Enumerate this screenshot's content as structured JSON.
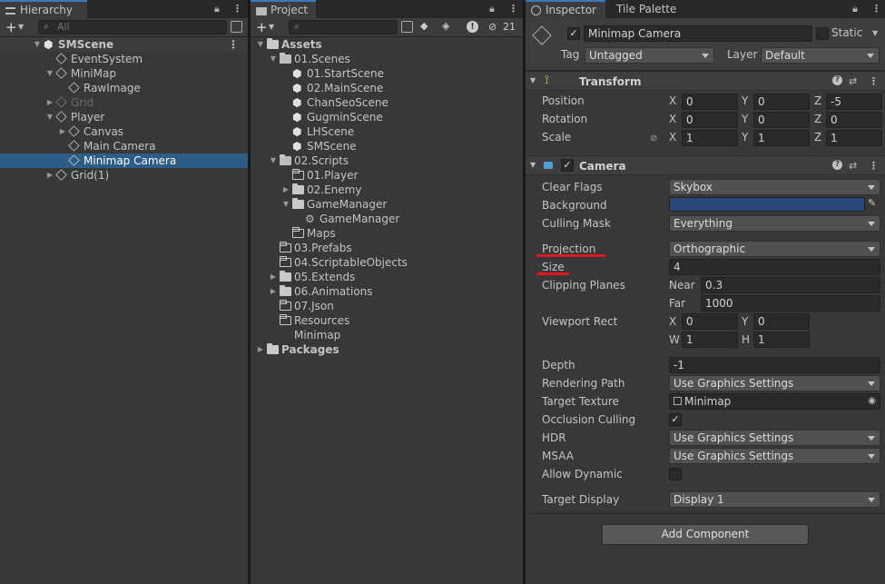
{
  "hierarchy": {
    "tab": "Hierarchy",
    "search_placeholder": "All",
    "rows": [
      {
        "label": "SMScene",
        "depth": 0,
        "fold": "open",
        "icon": "unity",
        "bold": true,
        "sel": false,
        "dim": false
      },
      {
        "label": "EventSystem",
        "depth": 1,
        "fold": "",
        "icon": "cube",
        "bold": false,
        "sel": false,
        "dim": false
      },
      {
        "label": "MiniMap",
        "depth": 1,
        "fold": "open",
        "icon": "cube",
        "bold": false,
        "sel": false,
        "dim": false
      },
      {
        "label": "RawImage",
        "depth": 2,
        "fold": "",
        "icon": "cube",
        "bold": false,
        "sel": false,
        "dim": false
      },
      {
        "label": "Grid",
        "depth": 1,
        "fold": "closed",
        "icon": "cube",
        "bold": false,
        "sel": false,
        "dim": true
      },
      {
        "label": "Player",
        "depth": 1,
        "fold": "open",
        "icon": "cube",
        "bold": false,
        "sel": false,
        "dim": false
      },
      {
        "label": "Canvas",
        "depth": 2,
        "fold": "closed",
        "icon": "cube",
        "bold": false,
        "sel": false,
        "dim": false
      },
      {
        "label": "Main Camera",
        "depth": 2,
        "fold": "",
        "icon": "cube",
        "bold": false,
        "sel": false,
        "dim": false
      },
      {
        "label": "Minimap Camera",
        "depth": 2,
        "fold": "",
        "icon": "cube",
        "bold": false,
        "sel": true,
        "dim": false
      },
      {
        "label": "Grid(1)",
        "depth": 1,
        "fold": "closed",
        "icon": "cube",
        "bold": false,
        "sel": false,
        "dim": false
      }
    ]
  },
  "project": {
    "tab": "Project",
    "hidden_count": "21",
    "rows": [
      {
        "label": "Assets",
        "depth": 0,
        "fold": "open",
        "icon": "folder",
        "bold": true
      },
      {
        "label": "01.Scenes",
        "depth": 1,
        "fold": "open",
        "icon": "folder-open",
        "bold": false
      },
      {
        "label": "01.StartScene",
        "depth": 2,
        "fold": "",
        "icon": "unity",
        "bold": false
      },
      {
        "label": "02.MainScene",
        "depth": 2,
        "fold": "",
        "icon": "unity",
        "bold": false
      },
      {
        "label": "ChanSeoScene",
        "depth": 2,
        "fold": "",
        "icon": "unity",
        "bold": false
      },
      {
        "label": "GugminScene",
        "depth": 2,
        "fold": "",
        "icon": "unity",
        "bold": false
      },
      {
        "label": "LHScene",
        "depth": 2,
        "fold": "",
        "icon": "unity",
        "bold": false
      },
      {
        "label": "SMScene",
        "depth": 2,
        "fold": "",
        "icon": "unity",
        "bold": false
      },
      {
        "label": "02.Scripts",
        "depth": 1,
        "fold": "open",
        "icon": "folder-open",
        "bold": false
      },
      {
        "label": "01.Player",
        "depth": 2,
        "fold": "",
        "icon": "folder-empty",
        "bold": false
      },
      {
        "label": "02.Enemy",
        "depth": 2,
        "fold": "closed",
        "icon": "folder",
        "bold": false
      },
      {
        "label": "GameManager",
        "depth": 2,
        "fold": "open",
        "icon": "folder",
        "bold": false
      },
      {
        "label": "GameManager",
        "depth": 3,
        "fold": "",
        "icon": "gear",
        "bold": false
      },
      {
        "label": "Maps",
        "depth": 2,
        "fold": "",
        "icon": "folder-empty",
        "bold": false
      },
      {
        "label": "03.Prefabs",
        "depth": 1,
        "fold": "",
        "icon": "folder-empty",
        "bold": false
      },
      {
        "label": "04.ScriptableObjects",
        "depth": 1,
        "fold": "",
        "icon": "folder-empty",
        "bold": false
      },
      {
        "label": "05.Extends",
        "depth": 1,
        "fold": "closed",
        "icon": "folder",
        "bold": false
      },
      {
        "label": "06.Animations",
        "depth": 1,
        "fold": "closed",
        "icon": "folder",
        "bold": false
      },
      {
        "label": "07.Json",
        "depth": 1,
        "fold": "",
        "icon": "folder-empty",
        "bold": false
      },
      {
        "label": "Resources",
        "depth": 1,
        "fold": "",
        "icon": "folder-empty",
        "bold": false
      },
      {
        "label": "Minimap",
        "depth": 1,
        "fold": "",
        "icon": "texture",
        "bold": false
      },
      {
        "label": "Packages",
        "depth": 0,
        "fold": "closed",
        "icon": "folder",
        "bold": true
      }
    ]
  },
  "inspector": {
    "tab": "Inspector",
    "tab2": "Tile Palette",
    "object_name": "Minimap Camera",
    "static_label": "Static",
    "tag_label": "Tag",
    "tag_value": "Untagged",
    "layer_label": "Layer",
    "layer_value": "Default",
    "transform": {
      "title": "Transform",
      "rows": [
        {
          "label": "Position",
          "x": "0",
          "y": "0",
          "z": "-5"
        },
        {
          "label": "Rotation",
          "x": "0",
          "y": "0",
          "z": "0"
        },
        {
          "label": "Scale",
          "x": "1",
          "y": "1",
          "z": "1"
        }
      ]
    },
    "axes": {
      "x": "X",
      "y": "Y",
      "z": "Z",
      "w": "W",
      "h": "H"
    },
    "camera": {
      "title": "Camera",
      "clear_flags_label": "Clear Flags",
      "clear_flags": "Skybox",
      "background_label": "Background",
      "background_color": "#284979",
      "culling_mask_label": "Culling Mask",
      "culling_mask": "Everything",
      "projection_label": "Projection",
      "projection": "Orthographic",
      "size_label": "Size",
      "size": "4",
      "clipping_label": "Clipping Planes",
      "near_label": "Near",
      "near": "0.3",
      "far_label": "Far",
      "far": "1000",
      "viewport_label": "Viewport Rect",
      "vx": "0",
      "vy": "0",
      "vw": "1",
      "vh": "1",
      "depth_label": "Depth",
      "depth": "-1",
      "rendering_path_label": "Rendering Path",
      "rendering_path": "Use Graphics Settings",
      "target_texture_label": "Target Texture",
      "target_texture": "Minimap",
      "occlusion_label": "Occlusion Culling",
      "hdr_label": "HDR",
      "hdr": "Use Graphics Settings",
      "msaa_label": "MSAA",
      "msaa": "Use Graphics Settings",
      "dynres_label": "Allow Dynamic Resolutio",
      "target_display_label": "Target Display",
      "target_display": "Display 1"
    },
    "add_component": "Add Component"
  },
  "colors": {
    "accent": "#3a79bb",
    "selection": "#2c5d87",
    "annotation": "#e1161d"
  }
}
